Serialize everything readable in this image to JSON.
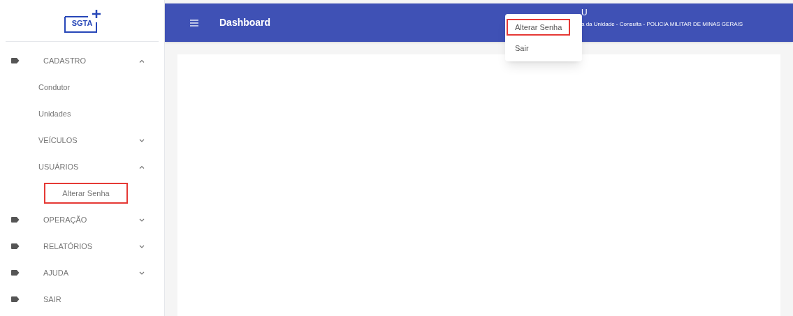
{
  "logo": {
    "text": "SGTA"
  },
  "sidebar": {
    "items": [
      {
        "label": "CADASTRO",
        "expanded": true,
        "children": [
          {
            "label": "Condutor"
          },
          {
            "label": "Unidades"
          },
          {
            "label": "VEÍCULOS",
            "expanded": false
          },
          {
            "label": "USUÁRIOS",
            "expanded": true,
            "children": [
              {
                "label": "Alterar Senha",
                "highlighted": true
              }
            ]
          }
        ]
      },
      {
        "label": "OPERAÇÃO",
        "expanded": false
      },
      {
        "label": "RELATÓRIOS",
        "expanded": false
      },
      {
        "label": "AJUDA",
        "expanded": false
      },
      {
        "label": "SAIR"
      }
    ]
  },
  "header": {
    "title": "Dashboard",
    "user_name": "U",
    "user_subtitle": "a da Unidade - Consulta - POLICIA MILITAR DE MINAS GERAIS"
  },
  "user_menu": {
    "items": [
      {
        "label": "Alterar Senha",
        "highlighted": true
      },
      {
        "label": "Sair",
        "highlighted": false
      }
    ]
  }
}
